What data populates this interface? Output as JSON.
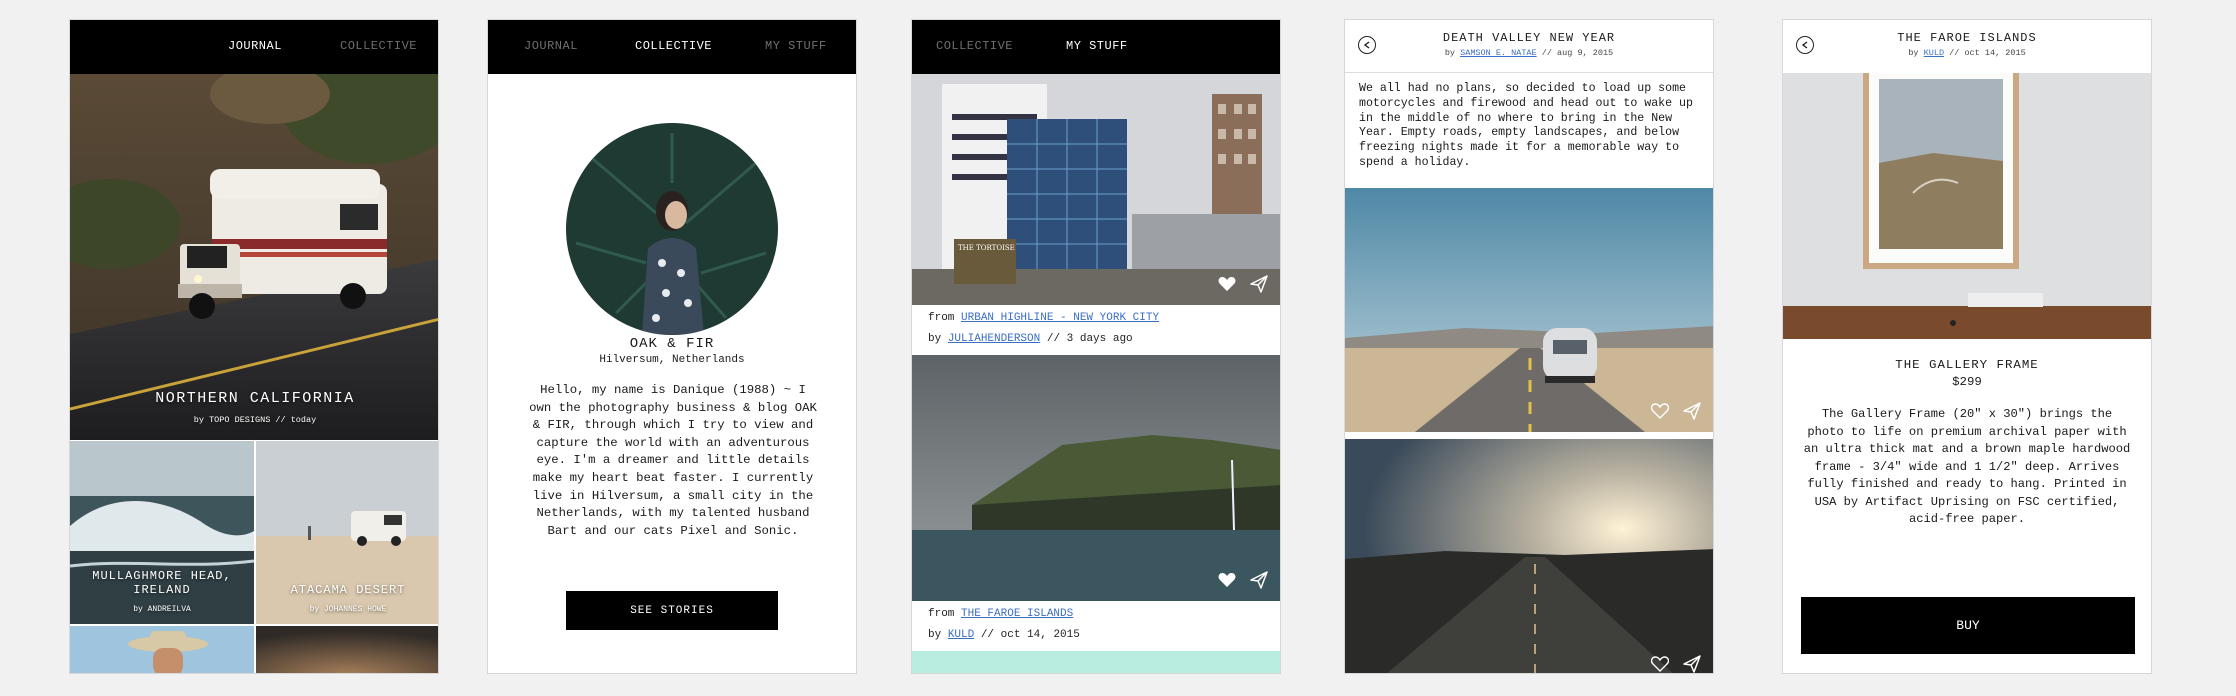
{
  "screen1": {
    "tabs": [
      "JOURNAL",
      "COLLECTIVE"
    ],
    "hero": {
      "title": "NORTHERN CALIFORNIA",
      "byline": "by TOPO DESIGNS // today"
    },
    "tiles": [
      {
        "title": "MULLAGHMORE HEAD, IRELAND",
        "byline": "by ANDREILVA"
      },
      {
        "title": "ATACAMA DESERT",
        "byline": "by JOHANNES HOWE"
      }
    ]
  },
  "screen2": {
    "tabs": [
      "JOURNAL",
      "COLLECTIVE",
      "MY STUFF"
    ],
    "name": "OAK & FIR",
    "location": "Hilversum, Netherlands",
    "bio": "Hello, my name is Danique (1988) ~ I own the photography business & blog OAK & FIR, through which I try to view and capture the world with an adventurous eye. I'm a dreamer and little details make my heart beat faster. I currently live in Hilversum, a small city in the Netherlands, with my talented husband Bart and our cats Pixel and Sonic.",
    "button": "SEE STORIES"
  },
  "screen3": {
    "tabs": [
      "COLLECTIVE",
      "MY STUFF"
    ],
    "sign_text": "THE TORTOISE",
    "posts": [
      {
        "from_label": "from",
        "story": "URBAN HIGHLINE - NEW YORK CITY",
        "by_label": "by",
        "author": "JULIAHENDERSON",
        "when": "// 3 days ago"
      },
      {
        "from_label": "from",
        "story": "THE FAROE ISLANDS",
        "by_label": "by",
        "author": "KULD",
        "when": "// oct 14, 2015"
      }
    ]
  },
  "screen4": {
    "title": "DEATH VALLEY NEW YEAR",
    "by_label": "by",
    "author": "SAMSON E. NATAE",
    "date": "// aug 9, 2015",
    "body": "We all had no plans, so decided to load up some motorcycles and firewood and head out to wake up in the middle of no where to bring in the New Year. Empty roads, empty landscapes, and below freezing nights made it for a memorable way to spend a holiday."
  },
  "screen5": {
    "title": "THE FAROE ISLANDS",
    "by_label": "by",
    "author": "KULD",
    "date": "// oct 14, 2015",
    "product": "THE GALLERY FRAME",
    "price": "$299",
    "description": "The Gallery Frame (20\" x 30\") brings the photo to life on premium archival paper with an ultra thick mat and a brown maple hardwood frame - 3/4\" wide and 1 1/2\" deep. Arrives fully finished and ready to hang. Printed in USA by Artifact Uprising on FSC certified, acid-free paper.",
    "button": "BUY"
  },
  "colors": {
    "link": "#3b6ec5",
    "nav_bg": "#000000",
    "page_bg": "#f1f1f2"
  }
}
